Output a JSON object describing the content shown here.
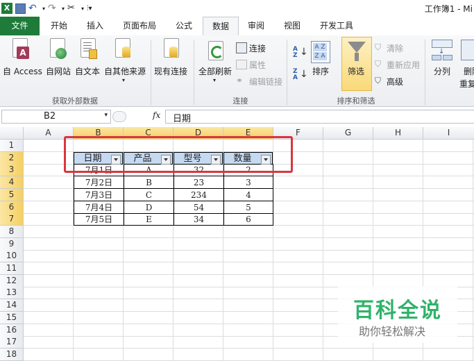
{
  "titlebar": {
    "title": "工作簿1 - Mi",
    "icons": [
      "excel-logo-icon",
      "save-icon",
      "undo-icon",
      "redo-icon",
      "tool-icon",
      "customize-icon"
    ]
  },
  "tabs": [
    "文件",
    "开始",
    "插入",
    "页面布局",
    "公式",
    "数据",
    "审阅",
    "视图",
    "开发工具"
  ],
  "active_tab": "数据",
  "ribbon": {
    "external": {
      "access": "自 Access",
      "web": "自网站",
      "text": "自文本",
      "other": "自其他来源",
      "group": "获取外部数据"
    },
    "existing": "现有连接",
    "refresh_all": "全部刷新",
    "connections": {
      "connect": "连接",
      "properties": "属性",
      "edit_links": "编辑链接",
      "group": "连接"
    },
    "sort": {
      "asc": "A↓Z",
      "desc": "Z↓A",
      "sort": "排序",
      "filter": "筛选",
      "clear": "清除",
      "reapply": "重新应用",
      "advanced": "高级",
      "group": "排序和筛选"
    },
    "text_to_columns": "分列",
    "remove_dup": "删除",
    "remove_dup2": "重复"
  },
  "formula_bar": {
    "name_box": "B2",
    "fx": "fx",
    "value": "日期"
  },
  "grid": {
    "columns": [
      "A",
      "B",
      "C",
      "D",
      "E",
      "F",
      "G",
      "H",
      "I"
    ],
    "rows": [
      "1",
      "2",
      "3",
      "4",
      "5",
      "6",
      "7",
      "8",
      "9",
      "10",
      "11",
      "12",
      "13",
      "14",
      "15",
      "16",
      "17",
      "18"
    ],
    "headers": [
      "日期",
      "产品",
      "型号",
      "数量"
    ],
    "data": [
      [
        "7月1日",
        "A",
        "32",
        "2"
      ],
      [
        "7月2日",
        "B",
        "23",
        "3"
      ],
      [
        "7月3日",
        "C",
        "234",
        "4"
      ],
      [
        "7月4日",
        "D",
        "54",
        "5"
      ],
      [
        "7月5日",
        "E",
        "34",
        "6"
      ]
    ]
  },
  "watermark": {
    "title": "百科全说",
    "subtitle": "助你轻松解决"
  },
  "colors": {
    "file_tab": "#1e7b3a",
    "highlight": "#d9363e",
    "header_fill": "#c5d9f1",
    "watermark": "#2fb36b"
  }
}
